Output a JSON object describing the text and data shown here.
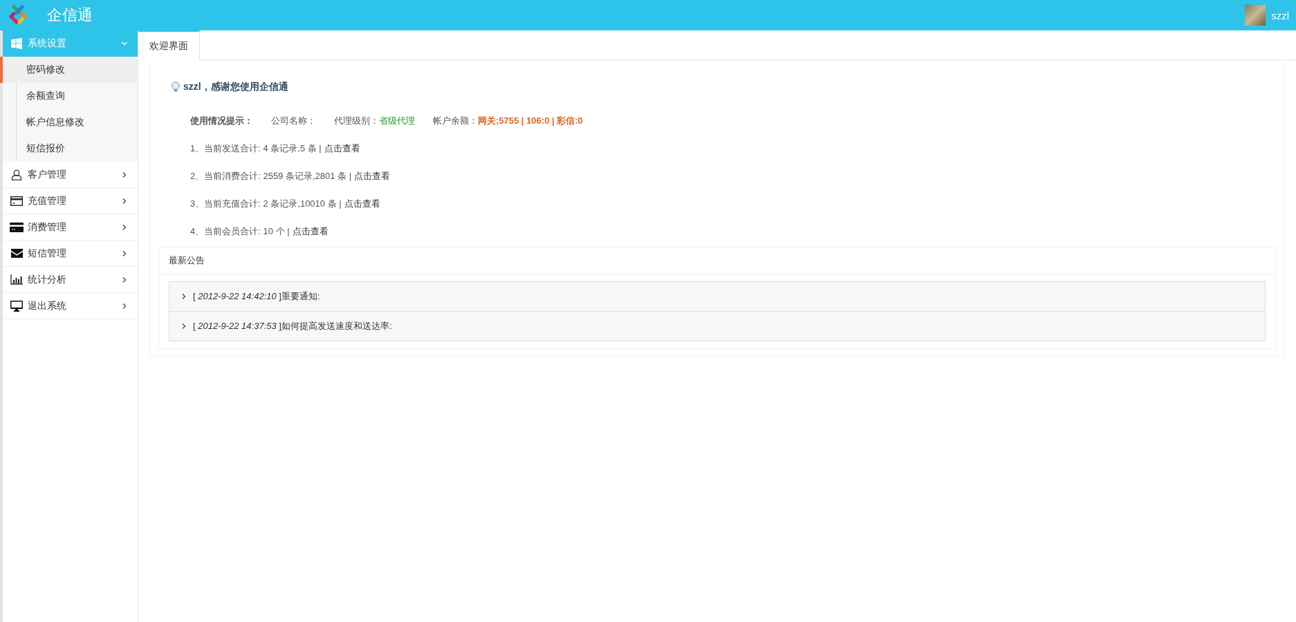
{
  "header": {
    "title": "企信通",
    "user": "szzl"
  },
  "sidebar": {
    "groups": [
      {
        "label": "系统设置",
        "expanded": true,
        "children": [
          {
            "label": "密码修改",
            "selected": true
          },
          {
            "label": "余额查询",
            "selected": false
          },
          {
            "label": "帐户信息修改",
            "selected": false
          },
          {
            "label": "短信报价",
            "selected": false
          }
        ]
      },
      {
        "label": "客户管理",
        "expanded": false
      },
      {
        "label": "充值管理",
        "expanded": false
      },
      {
        "label": "消费管理",
        "expanded": false
      },
      {
        "label": "短信管理",
        "expanded": false
      },
      {
        "label": "统计分析",
        "expanded": false
      },
      {
        "label": "退出系统",
        "expanded": false
      }
    ]
  },
  "tabs": [
    {
      "label": "欢迎界面",
      "selected": true
    }
  ],
  "welcome": {
    "greeting": "szzl，感谢您使用企信通",
    "usage_label": "使用情况提示：",
    "company_label": "公司名称：",
    "agent_label": "代理级别：",
    "agent_value": "省级代理",
    "balance_label": "帐户余额：",
    "balance_value": "网关;5755 | 106:0 | 彩信:0"
  },
  "stats": [
    {
      "text": "1、当前发送合计: 4 条记录,5 条 |",
      "link": "点击查看"
    },
    {
      "text": "2、当前消费合计: 2559 条记录,2801 条 |",
      "link": "点击查看"
    },
    {
      "text": "3、当前充值合计: 2 条记录,10010 条 |",
      "link": "点击查看"
    },
    {
      "text": "4、当前会员合计: 10 个 |",
      "link": "点击查看"
    }
  ],
  "notices": {
    "title": "最新公告",
    "items": [
      {
        "expanded": false,
        "text": "[ *2012-9-22 14:42:10* ]重要通知:"
      },
      {
        "expanded": false,
        "text": "[ *2012-9-22 14:37:53* ]如何提高发送速度和送达率:"
      }
    ]
  }
}
